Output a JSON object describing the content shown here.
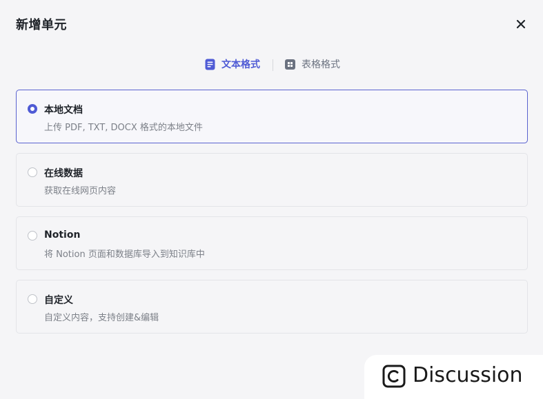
{
  "dialog": {
    "title": "新增单元"
  },
  "tabs": [
    {
      "label": "文本格式",
      "icon": "document-icon",
      "active": true
    },
    {
      "label": "表格格式",
      "icon": "table-icon",
      "active": false
    }
  ],
  "options": [
    {
      "title": "本地文档",
      "description": "上传 PDF, TXT, DOCX 格式的本地文件",
      "selected": true
    },
    {
      "title": "在线数据",
      "description": "获取在线网页内容",
      "selected": false
    },
    {
      "title": "Notion",
      "description": "将 Notion 页面和数据库导入到知识库中",
      "selected": false
    },
    {
      "title": "自定义",
      "description": "自定义内容，支持创建&编辑",
      "selected": false
    }
  ],
  "watermark": {
    "text": "Discussion",
    "icon": "copyright-c-icon"
  },
  "colors": {
    "accent": "#4f5bd5",
    "background": "#f5f5f7",
    "border": "#e3e4e8"
  }
}
